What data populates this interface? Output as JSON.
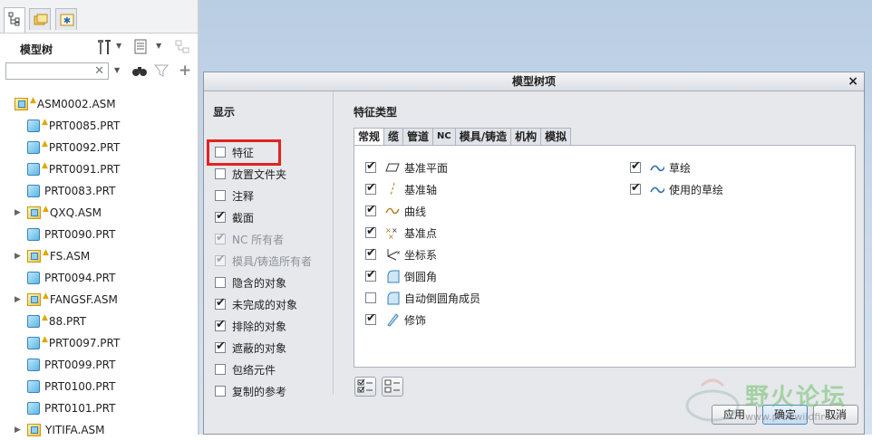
{
  "left_panel": {
    "title": "模型树",
    "search_value": "",
    "tree": [
      {
        "label": "ASM0002.ASM",
        "kind": "asm",
        "warn": true,
        "level": 0,
        "expandable": false
      },
      {
        "label": "PRT0085.PRT",
        "kind": "prt",
        "warn": true,
        "level": 1,
        "expandable": false
      },
      {
        "label": "PRT0092.PRT",
        "kind": "prt",
        "warn": true,
        "level": 1,
        "expandable": false
      },
      {
        "label": "PRT0091.PRT",
        "kind": "prt",
        "warn": true,
        "level": 1,
        "expandable": false
      },
      {
        "label": "PRT0083.PRT",
        "kind": "prt",
        "warn": false,
        "level": 1,
        "expandable": false
      },
      {
        "label": "QXQ.ASM",
        "kind": "asm",
        "warn": true,
        "level": 1,
        "expandable": true
      },
      {
        "label": "PRT0090.PRT",
        "kind": "prt",
        "warn": false,
        "level": 1,
        "expandable": false
      },
      {
        "label": "FS.ASM",
        "kind": "asm",
        "warn": true,
        "level": 1,
        "expandable": true
      },
      {
        "label": "PRT0094.PRT",
        "kind": "prt",
        "warn": false,
        "level": 1,
        "expandable": false
      },
      {
        "label": "FANGSF.ASM",
        "kind": "asm",
        "warn": true,
        "level": 1,
        "expandable": true
      },
      {
        "label": "88.PRT",
        "kind": "prt",
        "warn": true,
        "level": 1,
        "expandable": false
      },
      {
        "label": "PRT0097.PRT",
        "kind": "prt",
        "warn": true,
        "level": 1,
        "expandable": false
      },
      {
        "label": "PRT0099.PRT",
        "kind": "prt",
        "warn": false,
        "level": 1,
        "expandable": false
      },
      {
        "label": "PRT0100.PRT",
        "kind": "prt",
        "warn": false,
        "level": 1,
        "expandable": false
      },
      {
        "label": "PRT0101.PRT",
        "kind": "prt",
        "warn": false,
        "level": 1,
        "expandable": false
      },
      {
        "label": "YITIFA.ASM",
        "kind": "asm",
        "warn": false,
        "level": 1,
        "expandable": true
      }
    ]
  },
  "dialog": {
    "title": "模型树项",
    "close": "×",
    "display_heading": "显示",
    "display_items": [
      {
        "label": "特征",
        "checked": false,
        "disabled": false
      },
      {
        "label": "放置文件夹",
        "checked": false,
        "disabled": false
      },
      {
        "label": "注释",
        "checked": false,
        "disabled": false
      },
      {
        "label": "截面",
        "checked": true,
        "disabled": false
      },
      {
        "label": "NC 所有者",
        "checked": true,
        "disabled": true
      },
      {
        "label": "模具/铸造所有者",
        "checked": true,
        "disabled": true
      },
      {
        "label": "隐含的对象",
        "checked": false,
        "disabled": false
      },
      {
        "label": "未完成的对象",
        "checked": true,
        "disabled": false
      },
      {
        "label": "排除的对象",
        "checked": true,
        "disabled": false
      },
      {
        "label": "遮蔽的对象",
        "checked": true,
        "disabled": false
      },
      {
        "label": "包络元件",
        "checked": false,
        "disabled": false
      },
      {
        "label": "复制的参考",
        "checked": false,
        "disabled": false
      }
    ],
    "feature_heading": "特征类型",
    "tabs": [
      "常规",
      "缆",
      "管道",
      "NC",
      "模具/铸造",
      "机构",
      "模拟"
    ],
    "features_left": [
      {
        "label": "基准平面",
        "checked": true,
        "icon": "datum-plane-icon"
      },
      {
        "label": "基准轴",
        "checked": true,
        "icon": "datum-axis-icon"
      },
      {
        "label": "曲线",
        "checked": true,
        "icon": "curve-icon"
      },
      {
        "label": "基准点",
        "checked": true,
        "icon": "datum-point-icon"
      },
      {
        "label": "坐标系",
        "checked": true,
        "icon": "coord-system-icon"
      },
      {
        "label": "倒圆角",
        "checked": true,
        "icon": "round-icon"
      },
      {
        "label": "自动倒圆角成员",
        "checked": false,
        "icon": "auto-round-icon"
      },
      {
        "label": "修饰",
        "checked": true,
        "icon": "cosmetic-icon"
      }
    ],
    "features_right": [
      {
        "label": "草绘",
        "checked": true,
        "icon": "sketch-icon"
      },
      {
        "label": "使用的草绘",
        "checked": true,
        "icon": "used-sketch-icon"
      }
    ],
    "buttons": {
      "apply": "应用",
      "ok": "确定",
      "cancel": "取消"
    }
  },
  "watermark": {
    "text": "野火论坛",
    "url": "www.proewildfire.cn"
  }
}
